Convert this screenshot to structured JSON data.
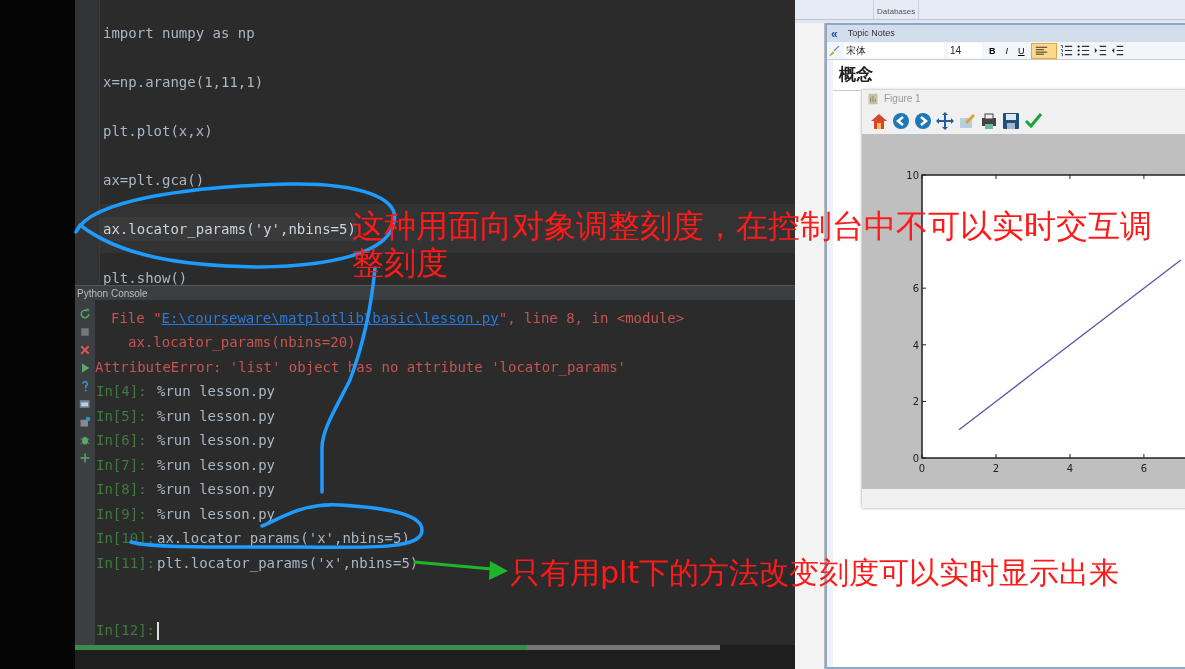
{
  "editor": {
    "lines": [
      {
        "text": "import numpy as np",
        "current": false
      },
      {
        "text": "x=np.arange(1,11,1)",
        "current": false
      },
      {
        "text": "plt.plot(x,x)",
        "current": false
      },
      {
        "text": "ax=plt.gca()",
        "current": false
      },
      {
        "text": "ax.locator_params('y',nbins=5)",
        "current": true
      },
      {
        "text": "plt.show()",
        "current": false
      }
    ]
  },
  "console": {
    "title": "Python Console",
    "lines": [
      {
        "kind": "traceback",
        "before": "File \"",
        "link": "E:\\courseware\\matplotlib\\basic\\lesson.py",
        "after": "\", line 8, in <module>"
      },
      {
        "kind": "source",
        "text": "ax.locator_params(nbins=20)"
      },
      {
        "kind": "error",
        "text": "AttributeError: 'list' object has no attribute 'locator_params'"
      },
      {
        "kind": "input",
        "prompt": "In[4]:",
        "text": "%run lesson.py"
      },
      {
        "kind": "input",
        "prompt": "In[5]:",
        "text": "%run lesson.py"
      },
      {
        "kind": "input",
        "prompt": "In[6]:",
        "text": "%run lesson.py"
      },
      {
        "kind": "input",
        "prompt": "In[7]:",
        "text": "%run lesson.py"
      },
      {
        "kind": "input",
        "prompt": "In[8]:",
        "text": "%run lesson.py"
      },
      {
        "kind": "input",
        "prompt": "In[9]:",
        "text": "%run lesson.py"
      },
      {
        "kind": "input",
        "prompt": "In[10]:",
        "text": "ax.locator_params('x',nbins=5)"
      },
      {
        "kind": "input",
        "prompt": "In[11]:",
        "text": "plt.locator_params('x',nbins=5)"
      }
    ],
    "current_prompt": "In[12]:",
    "progress": {
      "level": 0.7
    }
  },
  "ribbon": {
    "group": "Databases"
  },
  "notes": {
    "title": "Topic Notes",
    "collapse": "«",
    "font": "宋体",
    "size": "14",
    "format_buttons": [
      {
        "label": "B",
        "selected": false
      },
      {
        "label": "I",
        "selected": false
      },
      {
        "label": "U",
        "selected": false
      }
    ],
    "align": {
      "selected": true
    },
    "heading": "概念"
  },
  "figure": {
    "title": "Figure 1",
    "chart_data": {
      "type": "line",
      "x": [
        1,
        2,
        3,
        4,
        5,
        6,
        7
      ],
      "series": [
        {
          "color": "#5555aa",
          "values": [
            1,
            2,
            3,
            4,
            5,
            6,
            7
          ]
        }
      ],
      "xlim": [
        0,
        7.3
      ],
      "ylim": [
        0,
        10
      ],
      "xticks": [
        0,
        2,
        4,
        6
      ],
      "yticks": [
        0,
        2,
        4,
        6,
        10
      ]
    }
  },
  "annotations": [
    {
      "text": "这种用面向对象调整刻度，在控制台中不可以实时交互调整刻度"
    },
    {
      "text": "只有用plt下的方法改变刻度可以实时显示出来"
    }
  ]
}
